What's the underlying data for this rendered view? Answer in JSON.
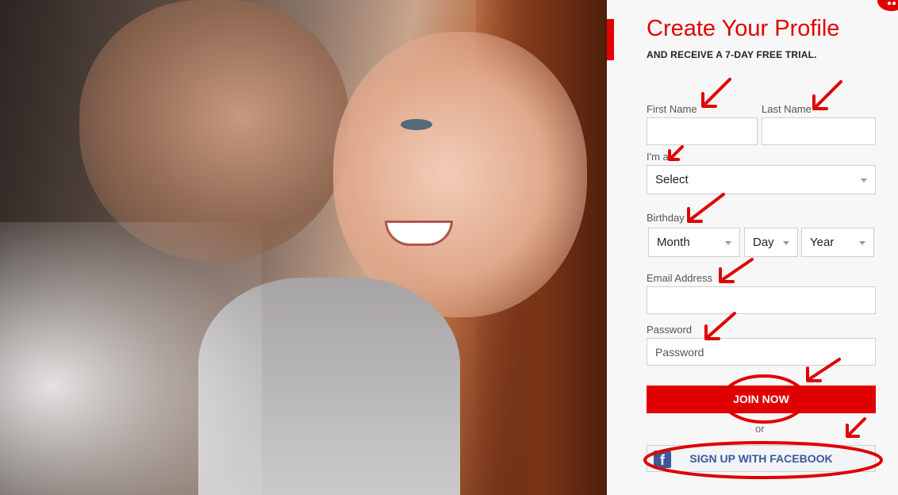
{
  "badge": "●●",
  "form": {
    "title": "Create Your Profile",
    "subtitle": "AND RECEIVE A 7-DAY FREE TRIAL.",
    "first_name_label": "First Name",
    "first_name_value": "",
    "last_name_label": "Last Name",
    "last_name_value": "",
    "gender_label": "I'm a",
    "gender_select": "Select",
    "birthday_label": "Birthday",
    "month_select": "Month",
    "day_select": "Day",
    "year_select": "Year",
    "email_label": "Email Address",
    "email_value": "",
    "password_label": "Password",
    "password_placeholder": "Password",
    "join_label": "JOIN NOW",
    "or_label": "or",
    "facebook_label": "SIGN UP WITH FACEBOOK",
    "facebook_glyph": "f"
  },
  "colors": {
    "accent": "#e10000",
    "facebook": "#3b5998",
    "annotation": "#e00000"
  },
  "icons": [
    "chevron-down-icon",
    "facebook-icon"
  ]
}
